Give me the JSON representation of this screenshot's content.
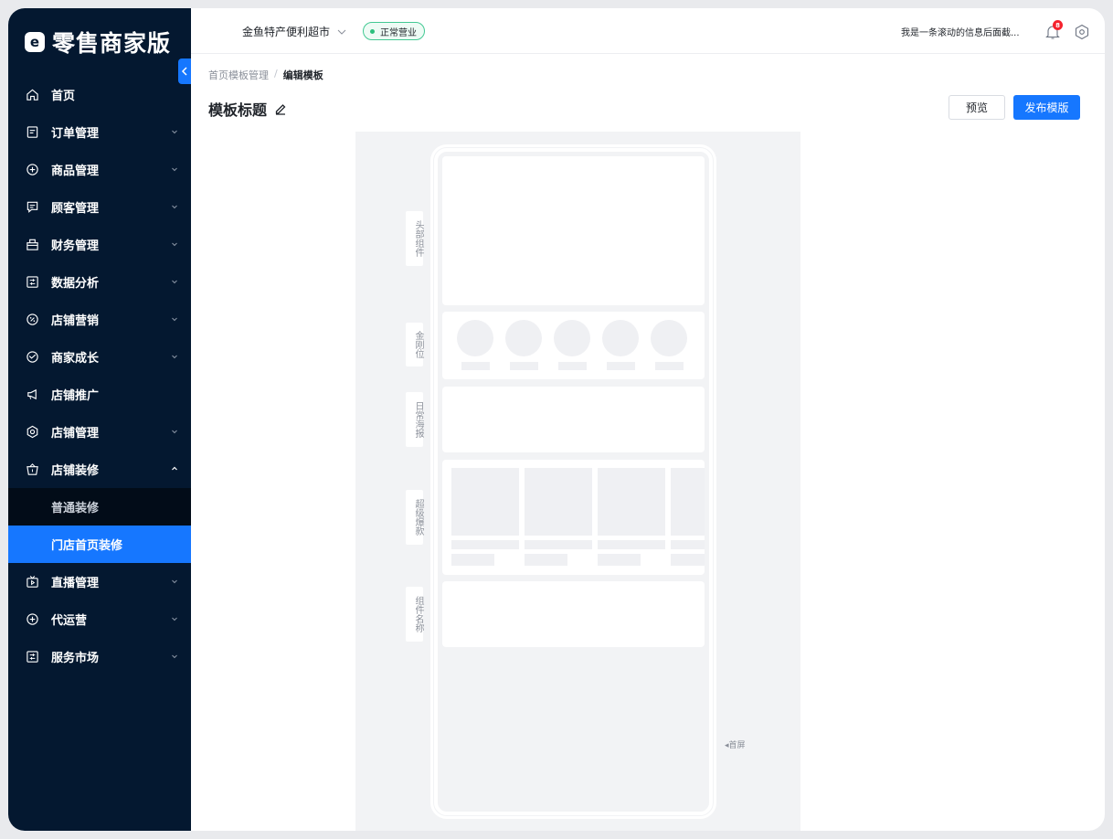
{
  "app": {
    "logo_mark": "e",
    "logo_text": "零售商家版"
  },
  "sidebar": {
    "items": [
      {
        "label": "首页",
        "icon": "home-icon",
        "expandable": false
      },
      {
        "label": "订单管理",
        "icon": "order-icon",
        "expandable": true
      },
      {
        "label": "商品管理",
        "icon": "product-icon",
        "expandable": true
      },
      {
        "label": "顾客管理",
        "icon": "customer-icon",
        "expandable": true
      },
      {
        "label": "财务管理",
        "icon": "finance-icon",
        "expandable": true
      },
      {
        "label": "数据分析",
        "icon": "data-icon",
        "expandable": true
      },
      {
        "label": "店铺营销",
        "icon": "marketing-icon",
        "expandable": true
      },
      {
        "label": "商家成长",
        "icon": "growth-icon",
        "expandable": true
      },
      {
        "label": "店铺推广",
        "icon": "megaphone-icon",
        "expandable": false
      },
      {
        "label": "店铺管理",
        "icon": "gear-icon",
        "expandable": true
      },
      {
        "label": "店铺装修",
        "icon": "basket-icon",
        "expandable": true,
        "expanded": true
      }
    ],
    "sub_items": [
      {
        "label": "普通装修",
        "active": false
      },
      {
        "label": "门店首页装修",
        "active": true
      }
    ],
    "items_after": [
      {
        "label": "直播管理",
        "icon": "tv-icon",
        "expandable": true
      },
      {
        "label": "代运营",
        "icon": "plus-circle-icon",
        "expandable": true
      },
      {
        "label": "服务市场",
        "icon": "market-icon",
        "expandable": true
      }
    ]
  },
  "header": {
    "store_name": "金鱼特产便利超市",
    "status": "正常营业",
    "marquee": "我是一条滚动的信息后面截...",
    "notification_count": "8"
  },
  "breadcrumb": {
    "parent": "首页模板管理",
    "separator": "/",
    "current": "编辑模板"
  },
  "page": {
    "title": "模板标题",
    "preview_label": "预览",
    "publish_label": "发布模版"
  },
  "editor": {
    "component_labels": [
      "头部组件",
      "金刚位",
      "日常海报",
      "超级爆款",
      "组件名称"
    ],
    "first_screen_marker": "◂首屏"
  },
  "colors": {
    "sidebar_bg": "#041830",
    "accent": "#1677ff",
    "status_green": "#2bbf7d"
  }
}
